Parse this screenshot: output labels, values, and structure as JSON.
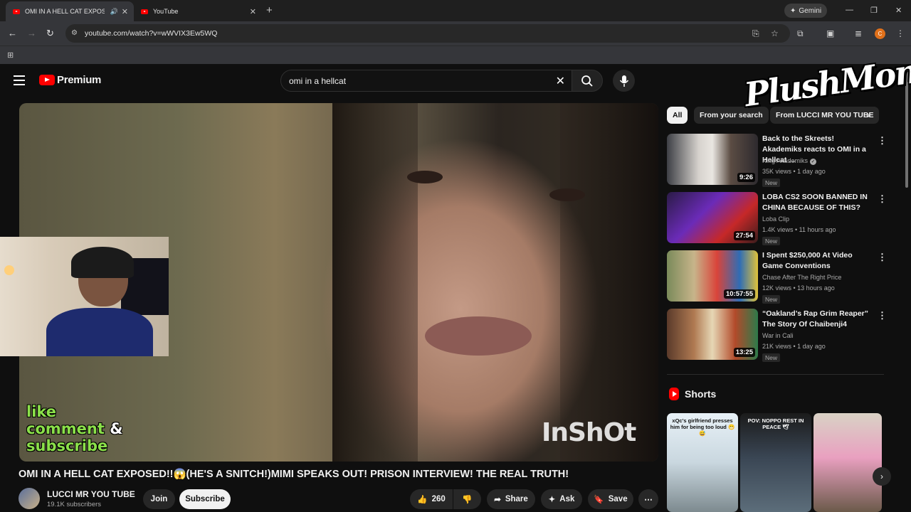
{
  "browser": {
    "tabs": [
      {
        "title": "OMI IN A HELL CAT EXPOSED!",
        "active": true
      },
      {
        "title": "YouTube",
        "active": false
      }
    ],
    "gemini_label": "Gemini",
    "url": "youtube.com/watch?v=wWVIX3Ew5WQ",
    "profile_initial": "C"
  },
  "header": {
    "logo_text": "Premium",
    "search_value": "omi in a hellcat"
  },
  "video": {
    "overlay_line1": "like",
    "overlay_line2": "comment",
    "overlay_amp": "&",
    "overlay_line3": "subscribe",
    "watermark": "InShOt",
    "title": "OMI IN A HELL CAT EXPOSED!!😱(HE'S A SNITCH!)MIMI SPEAKS OUT! PRISON INTERVIEW! THE REAL TRUTH!",
    "channel": "LUCCI MR YOU TUBE",
    "subscribers": "19.1K subscribers",
    "join_label": "Join",
    "subscribe_label": "Subscribe",
    "likes": "260",
    "share_label": "Share",
    "ask_label": "Ask",
    "save_label": "Save"
  },
  "chips": [
    "All",
    "From your search",
    "From LUCCI MR YOU TUBE"
  ],
  "recommendations": [
    {
      "title": "Back to the Skreets! Akademiks reacts to OMI in a Hellcat ...",
      "channel": "King Akademiks",
      "verified": true,
      "meta": "35K views • 1 day ago",
      "badge": "New",
      "duration": "9:26"
    },
    {
      "title": "LOBA CS2 SOON BANNED IN CHINA BECAUSE OF THIS?",
      "channel": "Loba Clip",
      "verified": false,
      "meta": "1.4K views • 11 hours ago",
      "badge": "New",
      "duration": "27:54"
    },
    {
      "title": "I Spent $250,000 At Video Game Conventions",
      "channel": "Chase After The Right Price",
      "verified": false,
      "meta": "12K views • 13 hours ago",
      "badge": "New",
      "duration": "10:57:55"
    },
    {
      "title": "“Oakland’s Rap Grim Reaper” The Story Of Chaibenji4",
      "channel": "War in Cali",
      "verified": false,
      "meta": "21K views • 1 day ago",
      "badge": "New",
      "duration": "13:25"
    }
  ],
  "shorts": {
    "heading": "Shorts",
    "items": [
      {
        "caption": "xQc's girlfriend presses him for being too loud 😬😅"
      },
      {
        "caption": "POV: NOPPO REST IN PEACE 🕊"
      },
      {
        "caption": ""
      }
    ]
  },
  "stream_watermark": "PlushMoney",
  "colors": {
    "brand": "#ff0000",
    "background": "#0f0f0f",
    "chip": "#272727"
  }
}
